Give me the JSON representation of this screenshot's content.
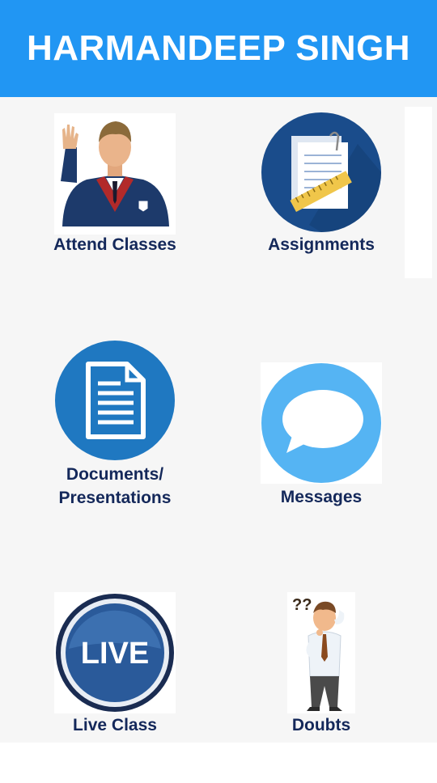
{
  "header": {
    "title": "HARMANDEEP SINGH"
  },
  "colors": {
    "header_bg": "#2196f3",
    "label": "#14285a",
    "background": "#f6f6f6"
  },
  "tiles": [
    {
      "label": "Attend Classes",
      "icon": "student-raising-hand-icon"
    },
    {
      "label": "Assignments",
      "icon": "assignment-papers-ruler-icon"
    },
    {
      "label": "Documents/\nPresentations",
      "label_line1": "Documents/",
      "label_line2": "Presentations",
      "icon": "document-icon"
    },
    {
      "label": "Messages",
      "icon": "chat-bubble-icon"
    },
    {
      "label": "Live Class",
      "icon": "live-badge-icon",
      "badge_text": "LIVE"
    },
    {
      "label": "Doubts",
      "icon": "confused-man-icon",
      "marks": "??"
    }
  ]
}
